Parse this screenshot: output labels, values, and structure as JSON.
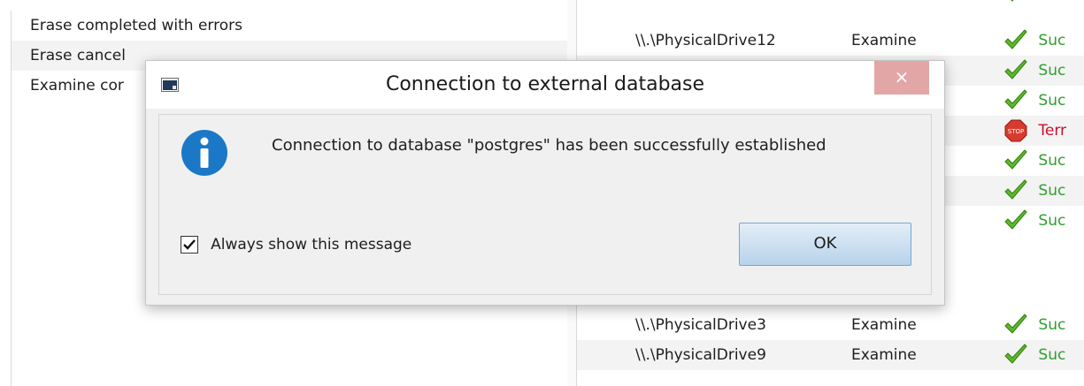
{
  "left_list": {
    "rows": [
      "Erase completed with errors",
      "Erase cancel",
      "Examine cor"
    ]
  },
  "right_list": {
    "rows": [
      {
        "device": "\\\\.\\PhysicalDrive12",
        "operation": "Examine",
        "status": "Suc",
        "kind": "success"
      },
      {
        "device": "",
        "operation": "",
        "status": "Suc",
        "kind": "success"
      },
      {
        "device": "",
        "operation": "",
        "status": "Suc",
        "kind": "success"
      },
      {
        "device": "",
        "operation": "",
        "status": "Terr",
        "kind": "error"
      },
      {
        "device": "",
        "operation": "",
        "status": "Suc",
        "kind": "success"
      },
      {
        "device": "",
        "operation": "",
        "status": "Suc",
        "kind": "success"
      },
      {
        "device": "",
        "operation": "",
        "status": "Suc",
        "kind": "success"
      },
      {
        "device": "\\\\.\\PhysicalDrive3",
        "operation": "Examine",
        "status": "Suc",
        "kind": "success"
      },
      {
        "device": "\\\\.\\PhysicalDrive9",
        "operation": "Examine",
        "status": "Suc",
        "kind": "success"
      }
    ],
    "colors": {
      "success": "#2f9e2f",
      "error": "#c8102e"
    }
  },
  "dialog": {
    "title": "Connection to external database",
    "close_label": "×",
    "icon": "info-icon",
    "message": "Connection to database \"postgres\" has been successfully established",
    "checkbox_label": "Always show this message",
    "checkbox_checked": true,
    "ok_label": "OK"
  }
}
